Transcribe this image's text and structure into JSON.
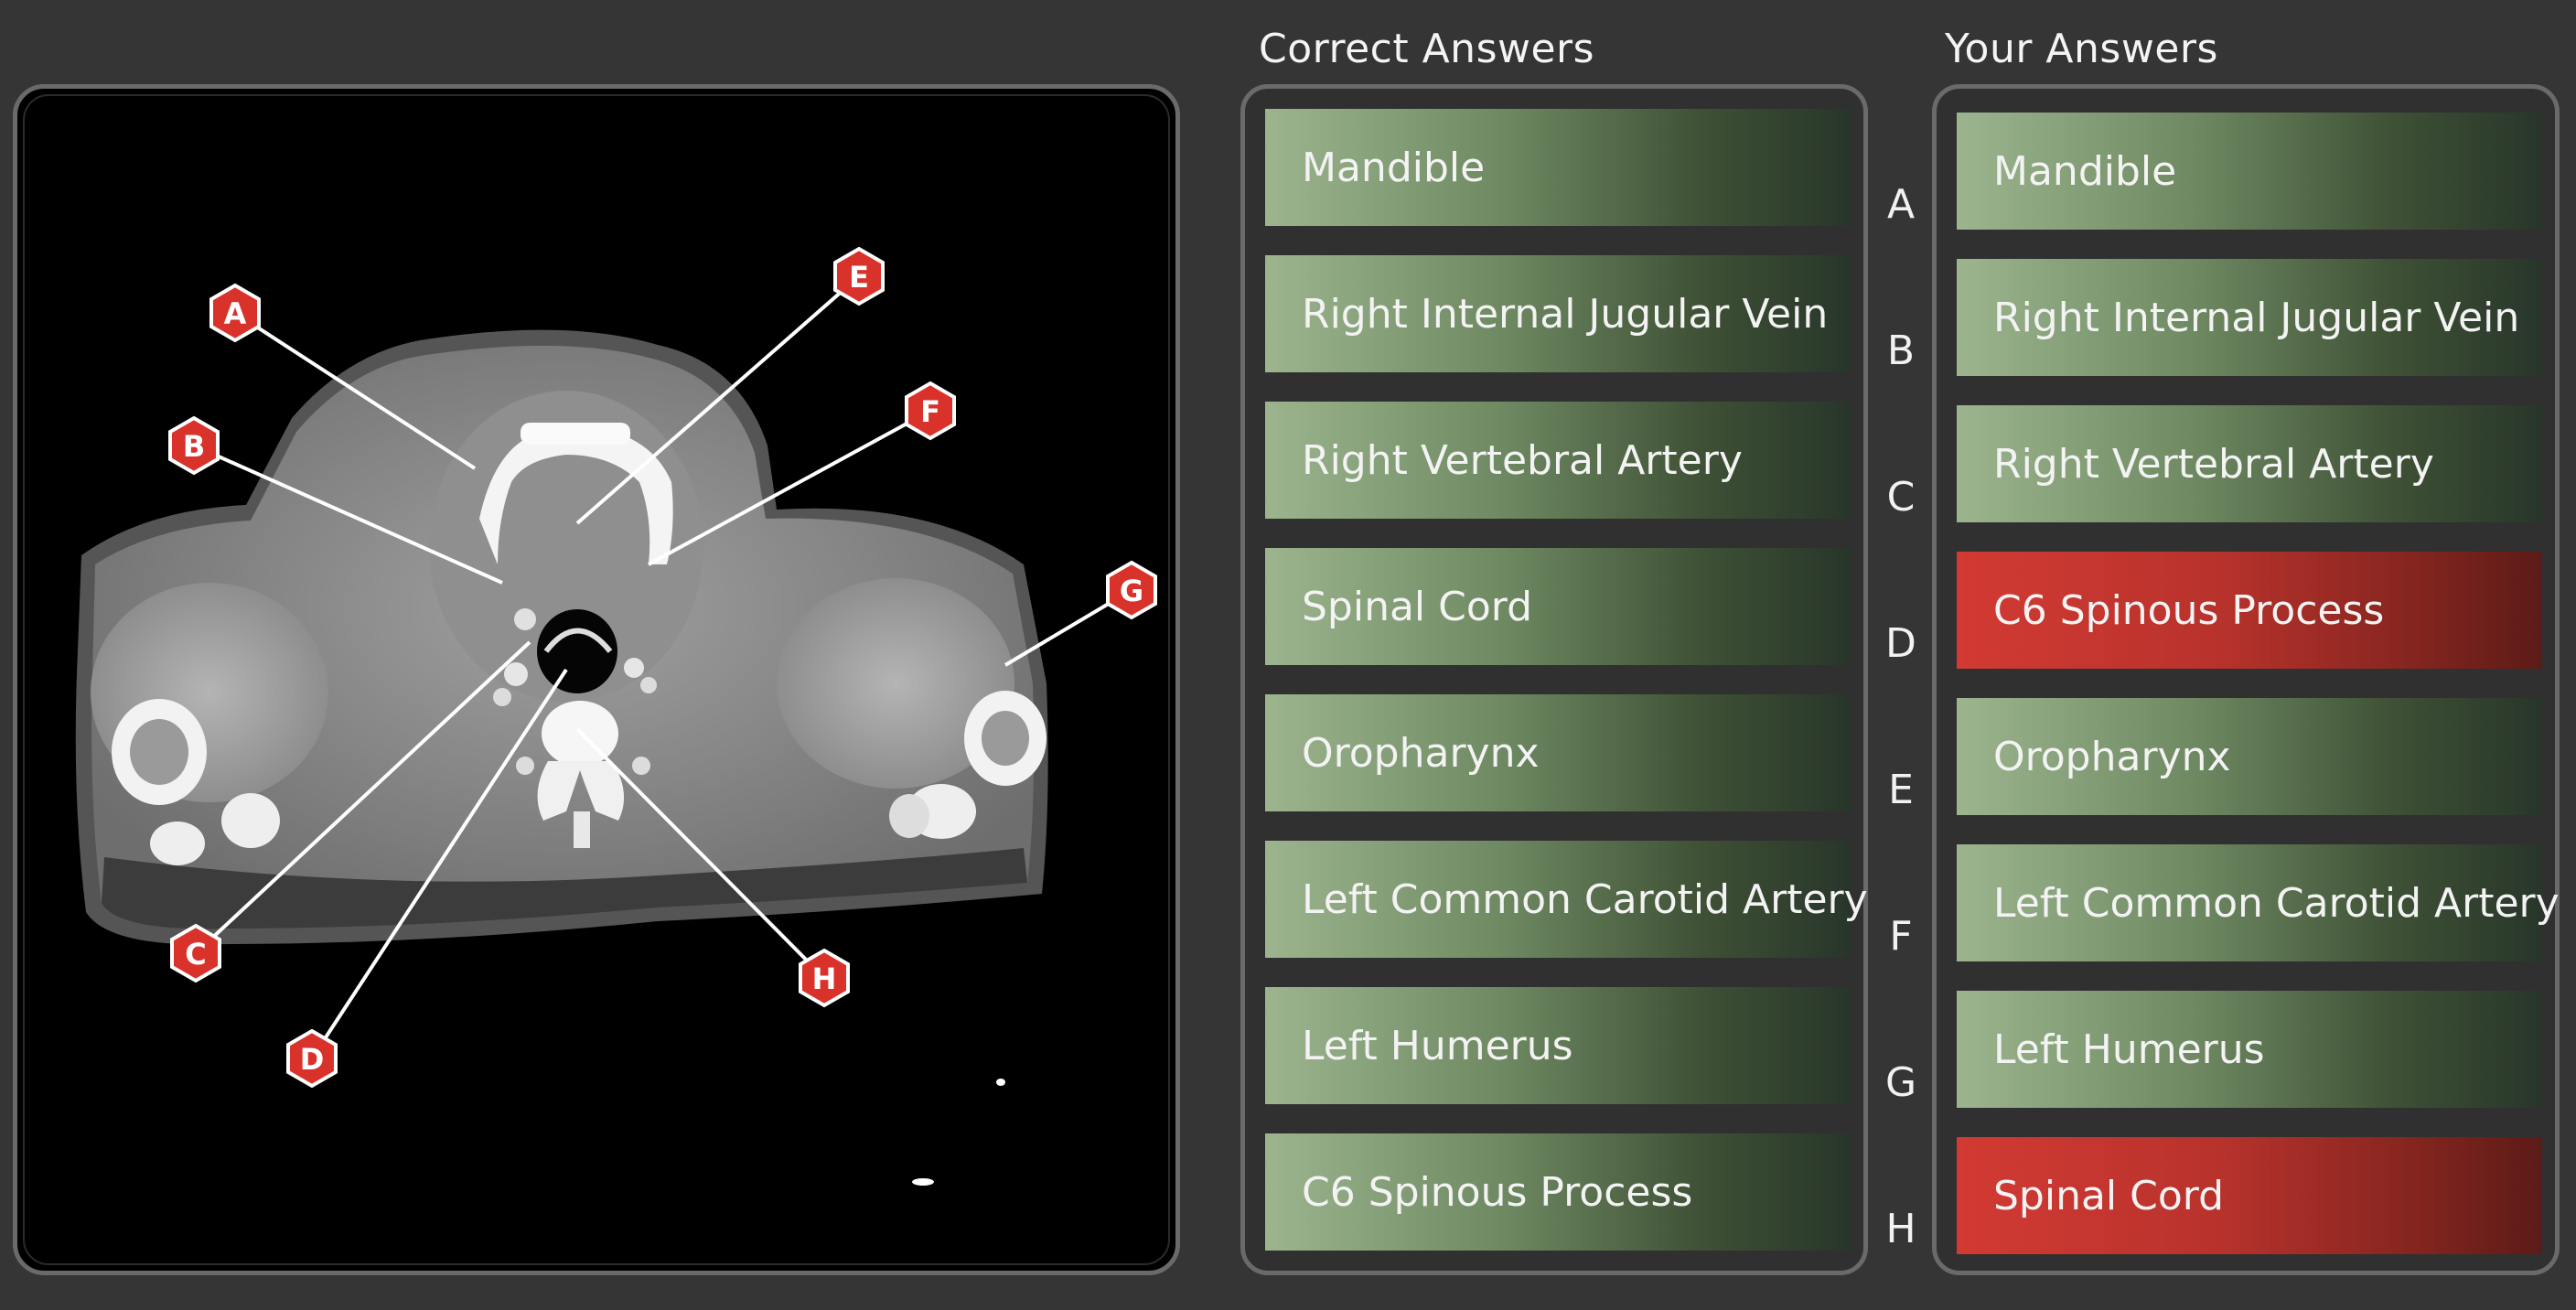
{
  "headers": {
    "correct_title": "Correct Answers",
    "your_title": "Your Answers"
  },
  "markers": [
    "A",
    "B",
    "C",
    "D",
    "E",
    "F",
    "G",
    "H"
  ],
  "correct_answers": [
    "Mandible",
    "Right Internal Jugular Vein",
    "Right Vertebral Artery",
    "Spinal Cord",
    "Oropharynx",
    "Left Common Carotid Artery",
    "Left Humerus",
    "C6 Spinous Process"
  ],
  "your_answers": [
    {
      "label": "Mandible",
      "status": "correct"
    },
    {
      "label": "Right Internal Jugular Vein",
      "status": "correct"
    },
    {
      "label": "Right Vertebral Artery",
      "status": "correct"
    },
    {
      "label": "C6 Spinous Process",
      "status": "incorrect"
    },
    {
      "label": "Oropharynx",
      "status": "correct"
    },
    {
      "label": "Left Common Carotid Artery",
      "status": "correct"
    },
    {
      "label": "Left Humerus",
      "status": "correct"
    },
    {
      "label": "Spinal Cord",
      "status": "incorrect"
    }
  ],
  "colors": {
    "correct": "#9cb58f",
    "incorrect": "#d23a33",
    "marker": "#d9322b"
  }
}
